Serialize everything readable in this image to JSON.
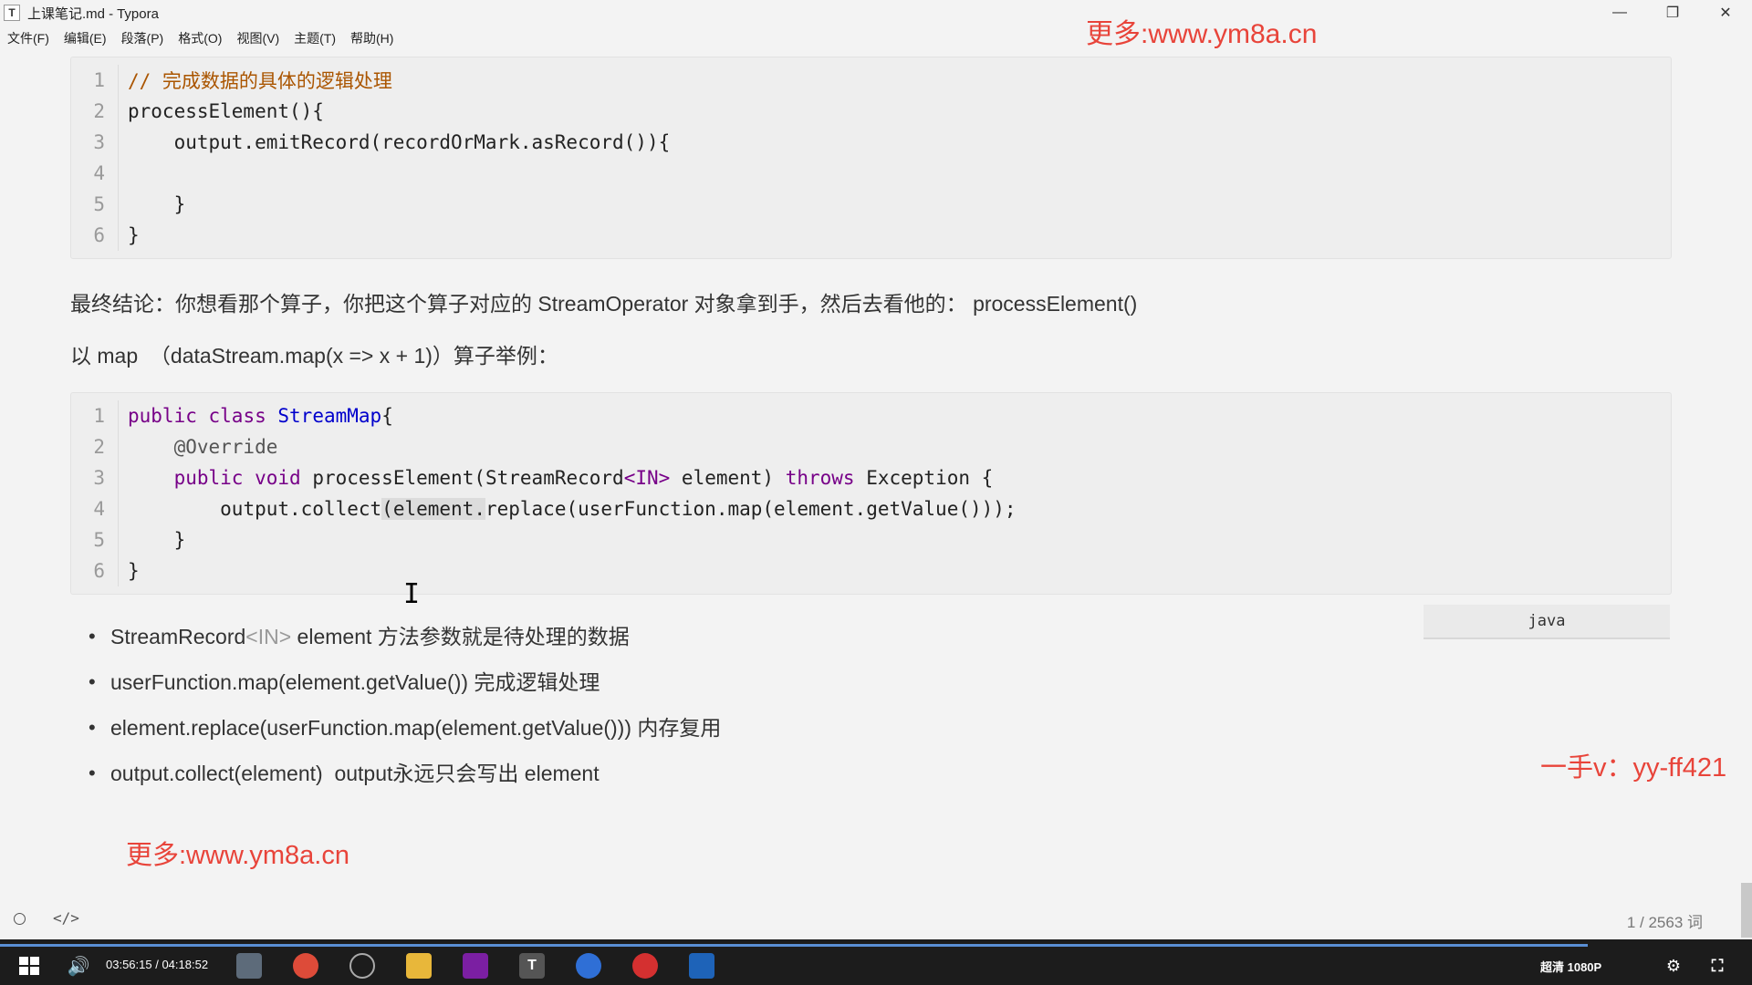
{
  "window": {
    "app_icon_letter": "T",
    "title": "上课笔记.md - Typora",
    "minimize": "—",
    "maximize": "❐",
    "close": "✕"
  },
  "menu": [
    "文件(F)",
    "编辑(E)",
    "段落(P)",
    "格式(O)",
    "视图(V)",
    "主题(T)",
    "帮助(H)"
  ],
  "watermarks": {
    "top": "更多:www.ym8a.cn",
    "bottom": "更多:www.ym8a.cn",
    "right": "一手v：yy-ff421"
  },
  "code_block_1": {
    "line_numbers": [
      "1",
      "2",
      "3",
      "4",
      "5",
      "6"
    ],
    "lines": [
      "// 完成数据的具体的逻辑处理",
      "processElement(){",
      "    output.emitRecord(recordOrMark.asRecord()){",
      "",
      "    }",
      "}"
    ]
  },
  "paragraph_1": "最终结论：你想看那个算子，你把这个算子对应的 StreamOperator 对象拿到手，然后去看他的： processElement()",
  "paragraph_2": "以 map  （dataStream.map(x => x + 1)）算子举例：",
  "code_block_2": {
    "line_numbers": [
      "1",
      "2",
      "3",
      "4",
      "5",
      "6"
    ],
    "tokens": {
      "public": "public",
      "class": "class",
      "class_name": "StreamMap",
      "brace_open": "{",
      "override": "@Override",
      "void": "void",
      "method_sig": "processElement(StreamRecord",
      "generic": "<IN>",
      "param": " element) ",
      "throws": "throws",
      "exception": " Exception {",
      "collect_prefix": "output.collect",
      "collect_hl": "(element.",
      "collect_rest": "replace(userFunction.map(element.getValue()));",
      "inner_close": "}",
      "outer_close": "}"
    },
    "language": "java"
  },
  "bullets": [
    {
      "pre": "StreamRecord",
      "gray": "<IN>",
      "post": " element 方法参数就是待处理的数据"
    },
    {
      "pre": "userFunction.map(element.getValue()) 完成逻辑处理",
      "gray": "",
      "post": ""
    },
    {
      "pre": "element.replace(userFunction.map(element.getValue())) 内存复用",
      "gray": "",
      "post": ""
    },
    {
      "pre": "output.collect(element)  output永远只会写出 element",
      "gray": "",
      "post": ""
    }
  ],
  "status": {
    "source_icon": "</>",
    "word_count": "1 / 2563 词"
  },
  "taskbar": {
    "time": "03:56:15 / 04:18:52",
    "quality": "超清 1080P",
    "apps": [
      "windows-icon",
      "volume-icon",
      "file-explorer-icon",
      "chrome-icon",
      "unity-icon",
      "folder-icon",
      "intellij-icon",
      "typora-icon",
      "browser-icon",
      "netease-icon",
      "photos-icon"
    ],
    "typora_letter": "T"
  }
}
